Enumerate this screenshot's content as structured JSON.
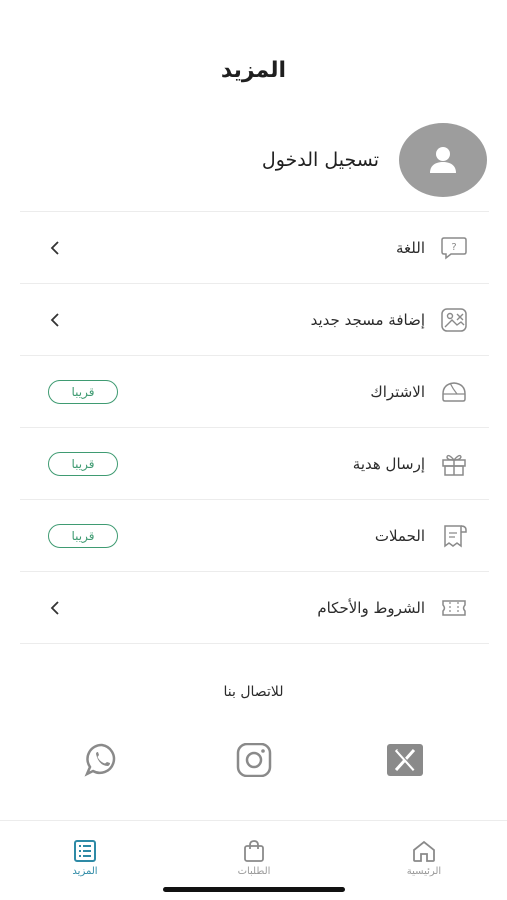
{
  "header": {
    "title": "المزيد"
  },
  "profile": {
    "login_label": "تسجيل الدخول",
    "avatar_icon": "person-icon"
  },
  "menu": {
    "items": [
      {
        "label": "اللغة",
        "icon": "help-bubble-icon",
        "trailing": "chevron"
      },
      {
        "label": "إضافة مسجد جديد",
        "icon": "add-image-icon",
        "trailing": "chevron"
      },
      {
        "label": "الاشتراك",
        "icon": "subscription-icon",
        "trailing": "badge",
        "badge": "قريبا"
      },
      {
        "label": "إرسال هدية",
        "icon": "gift-icon",
        "trailing": "badge",
        "badge": "قريبا"
      },
      {
        "label": "الحملات",
        "icon": "campaign-icon",
        "trailing": "badge",
        "badge": "قريبا"
      },
      {
        "label": "الشروط والأحكام",
        "icon": "ticket-icon",
        "trailing": "chevron"
      }
    ]
  },
  "contact": {
    "title": "للاتصال بنا",
    "socials": [
      "x-icon",
      "instagram-icon",
      "whatsapp-icon"
    ]
  },
  "tabbar": {
    "tabs": [
      {
        "label": "الرئيسية",
        "icon": "home-icon",
        "active": false
      },
      {
        "label": "الطلبات",
        "icon": "bag-icon",
        "active": false
      },
      {
        "label": "المزيد",
        "icon": "list-icon",
        "active": true
      }
    ]
  },
  "colors": {
    "accent": "#2e8aa6",
    "badge": "#3f9b72",
    "avatar": "#9d9d9d"
  }
}
